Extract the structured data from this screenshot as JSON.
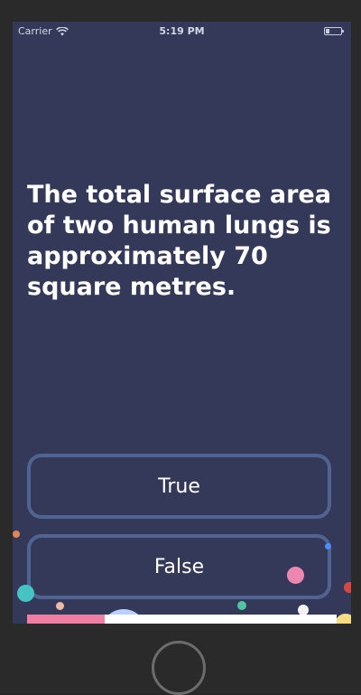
{
  "status_bar": {
    "carrier": "Carrier",
    "time": "5:19 PM",
    "wifi_icon": "wifi-icon",
    "battery_icon": "battery-icon"
  },
  "question": {
    "text": "The total surface area of two human lungs is approximately 70 square metres."
  },
  "answers": {
    "true_label": "True",
    "false_label": "False"
  },
  "progress": {
    "fraction": 0.25
  },
  "colors": {
    "background": "#34395a",
    "button_border": "#4f6493",
    "progress_fill": "#ef7fa2",
    "progress_track": "#ffffff"
  }
}
